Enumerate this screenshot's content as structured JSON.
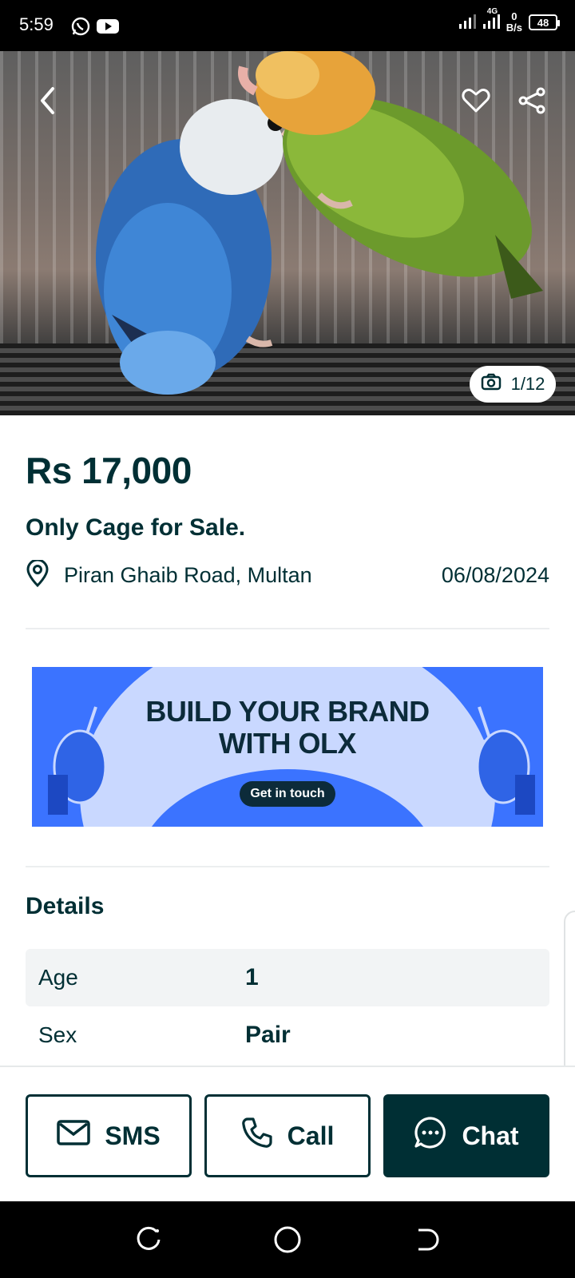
{
  "status_bar": {
    "time": "5:59",
    "network_label": "4G",
    "net_speed_value": "0",
    "net_speed_unit": "B/s",
    "battery": "48"
  },
  "hero": {
    "photo_counter": "1/12"
  },
  "listing": {
    "price": "Rs 17,000",
    "title": "Only Cage for Sale.",
    "location": "Piran Ghaib Road, Multan",
    "date": "06/08/2024"
  },
  "banner": {
    "line1": "BUILD YOUR BRAND",
    "line2": "WITH OLX",
    "cta": "Get in touch"
  },
  "details": {
    "heading": "Details",
    "rows": [
      {
        "key": "Age",
        "value": "1"
      },
      {
        "key": "Sex",
        "value": "Pair"
      }
    ]
  },
  "actions": {
    "sms": "SMS",
    "call": "Call",
    "chat": "Chat"
  },
  "colors": {
    "brand_dark": "#002f34",
    "banner_blue": "#3b73ff",
    "banner_light": "#c9d8ff",
    "row_shade": "#f2f4f5"
  },
  "icons": [
    "back-arrow-icon",
    "heart-icon",
    "share-icon",
    "camera-icon",
    "location-pin-icon",
    "mail-icon",
    "phone-icon",
    "chat-bubble-icon",
    "whatsapp-icon",
    "youtube-icon"
  ]
}
